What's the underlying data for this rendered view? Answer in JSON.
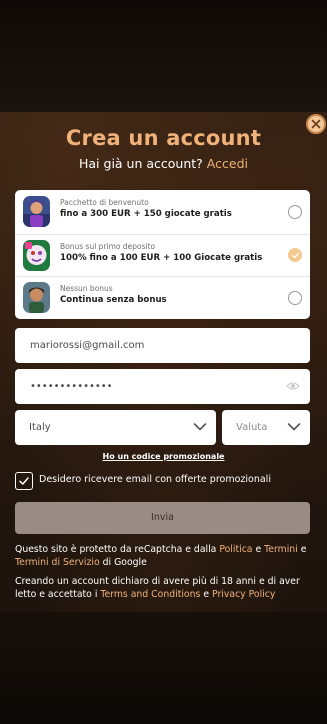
{
  "header": {
    "title": "Crea un account",
    "subtitle_text": "Hai già un account?",
    "login_link": "Accedi"
  },
  "bonuses": [
    {
      "small": "Pacchetto di benvenuto",
      "big": "fino a 300 EUR + 150 giocate gratis",
      "selected": false
    },
    {
      "small": "Bonus sul primo deposito",
      "big": "100% fino a 100 EUR + 100 Giocate gratis",
      "selected": true
    },
    {
      "small": "Nessun bonus",
      "big": "Continua senza bonus",
      "selected": false
    }
  ],
  "form": {
    "email_value": "mariorossi@gmail.com",
    "password_value": "••••••••••••••",
    "country_value": "Italy",
    "currency_placeholder": "Valuta",
    "promo_link": "Ho un codice promozionale",
    "newsletter_label": "Desidero ricevere email con offerte promozionali",
    "newsletter_checked": true,
    "submit_label": "Invia"
  },
  "legal": {
    "recaptcha_pre": "Questo sito è protetto da reCaptcha e dalla ",
    "privacy_policy_google": "Politica",
    "and1": " e ",
    "terms_google": "Termini",
    "and2": " e ",
    "terms_service": "Termini di Servizio",
    "recaptcha_post": " di Google",
    "age_pre": "Creando un account dichiaro di avere più di 18 anni e di aver letto e accettato i ",
    "terms_conditions": "Terms and Conditions",
    "and3": " e ",
    "privacy_policy": "Privacy Policy"
  },
  "colors": {
    "accent": "#f0b27a",
    "radio_selected": "#f4c98f",
    "submit_bg": "#9a8c84"
  },
  "icons": {
    "close": "close-icon",
    "eye": "eye-icon",
    "chevron": "chevron-down-icon",
    "check": "check-icon"
  }
}
